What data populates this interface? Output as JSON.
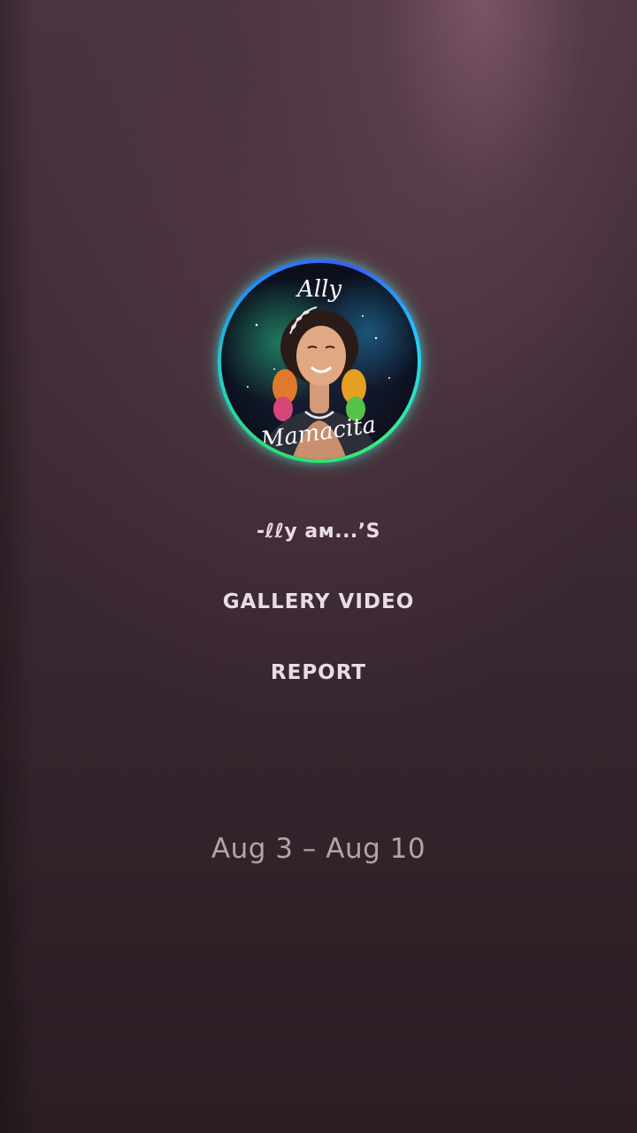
{
  "logo": {
    "text_top": "Ally",
    "text_bottom": "Mamacita",
    "ring_colors": [
      "#2fe06a",
      "#1fd3c0",
      "#1e8dff",
      "#3a5cff"
    ]
  },
  "menu": {
    "title": "-ℓℓy ам...’S",
    "gallery_video": "GALLERY VIDEO",
    "report": "REPORT"
  },
  "date_range": "Aug 3 – Aug 10"
}
